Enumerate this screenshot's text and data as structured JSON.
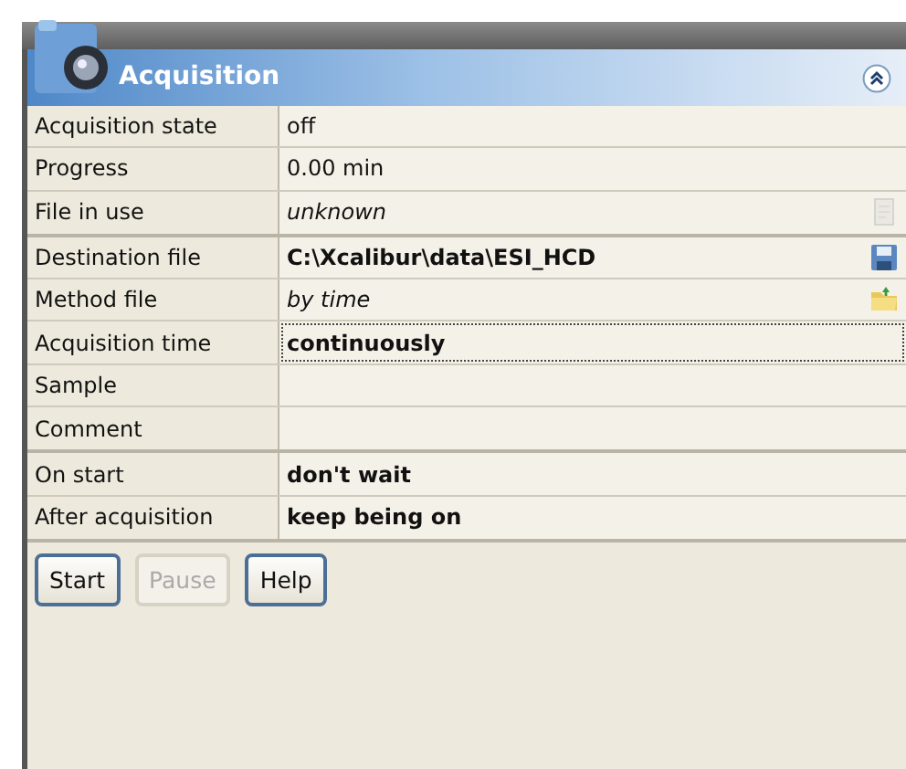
{
  "panel": {
    "title": "Acquisition",
    "expanded": true
  },
  "groups": [
    {
      "rows": [
        {
          "label": "Acquisition state",
          "value": "off",
          "kind": "readout",
          "focused": false
        },
        {
          "label": "Progress",
          "value": "0.00 min",
          "kind": "readout",
          "focused": false
        },
        {
          "label": "File in use",
          "value": "unknown",
          "kind": "file_readout",
          "focused": false
        }
      ]
    },
    {
      "rows": [
        {
          "label": "Destination file",
          "value": "C:\\Xcalibur\\data\\ESI_HCD",
          "kind": "file_path",
          "focused": false
        },
        {
          "label": "Method file",
          "value": "by time",
          "kind": "file_default",
          "focused": false
        },
        {
          "label": "Acquisition time",
          "value": "continuously",
          "kind": "choice",
          "focused": true
        },
        {
          "label": "Sample",
          "kind": "text",
          "focused": false
        },
        {
          "label": "Comment",
          "kind": "text",
          "focused": false
        }
      ]
    },
    {
      "rows": [
        {
          "label": "On start",
          "value": "don't wait",
          "kind": "choice",
          "focused": false
        },
        {
          "label": "After acquisition",
          "value": "keep being on",
          "kind": "choice",
          "focused": false
        }
      ]
    }
  ],
  "buttons": [
    {
      "label": "Start",
      "disabled": false
    },
    {
      "label": "Pause",
      "disabled": true
    },
    {
      "label": "Help",
      "disabled": false
    }
  ]
}
